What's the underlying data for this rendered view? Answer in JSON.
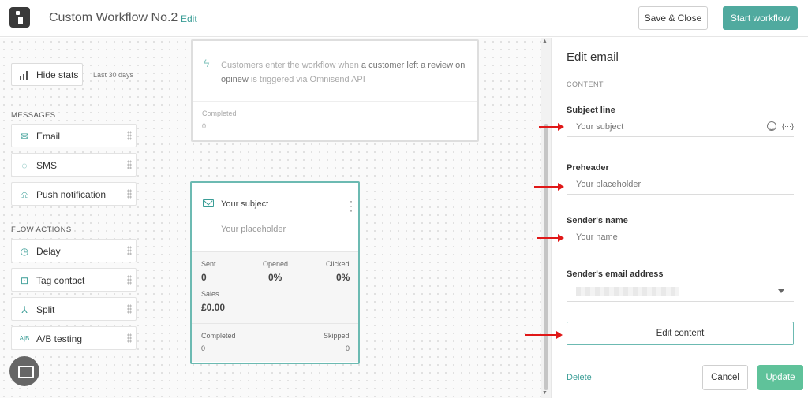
{
  "header": {
    "title": "Custom Workflow No.2",
    "edit_link": "Edit",
    "save_close": "Save & Close",
    "start_workflow": "Start workflow"
  },
  "sidebar": {
    "hide_stats": "Hide stats",
    "period": "Last 30 days",
    "messages_heading": "MESSAGES",
    "messages": [
      {
        "label": "Email",
        "icon": "envelope-icon"
      },
      {
        "label": "SMS",
        "icon": "sms-icon"
      },
      {
        "label": "Push notification",
        "icon": "bell-icon"
      }
    ],
    "actions_heading": "FLOW ACTIONS",
    "actions": [
      {
        "label": "Delay",
        "icon": "clock-icon"
      },
      {
        "label": "Tag contact",
        "icon": "tag-contact-icon"
      },
      {
        "label": "Split",
        "icon": "split-icon"
      },
      {
        "label": "A/B testing",
        "icon": "ab-test-icon"
      }
    ]
  },
  "trigger": {
    "text_prefix": "Customers enter the workflow when",
    "text_bold": "a customer left a review on opinew",
    "text_suffix": "is triggered via Omnisend API",
    "completed_label": "Completed",
    "completed_value": "0"
  },
  "email_node": {
    "subject": "Your subject",
    "preheader": "Your placeholder",
    "sent_label": "Sent",
    "sent_value": "0",
    "opened_label": "Opened",
    "opened_value": "0%",
    "clicked_label": "Clicked",
    "clicked_value": "0%",
    "sales_label": "Sales",
    "sales_value": "£0.00",
    "completed_label": "Completed",
    "completed_value": "0",
    "skipped_label": "Skipped",
    "skipped_value": "0"
  },
  "panel": {
    "title": "Edit email",
    "section": "CONTENT",
    "subject_label": "Subject line",
    "subject_placeholder": "Your subject",
    "personalization_token": "{···}",
    "preheader_label": "Preheader",
    "preheader_placeholder": "Your placeholder",
    "sender_name_label": "Sender's name",
    "sender_name_placeholder": "Your name",
    "sender_email_label": "Sender's email address",
    "edit_content": "Edit content",
    "delete": "Delete",
    "cancel": "Cancel",
    "update": "Update"
  },
  "colors": {
    "accent": "#3a9d96",
    "start_button": "#50aa9f",
    "update_button": "#5fc29a",
    "annotation_arrow": "#e01818"
  }
}
